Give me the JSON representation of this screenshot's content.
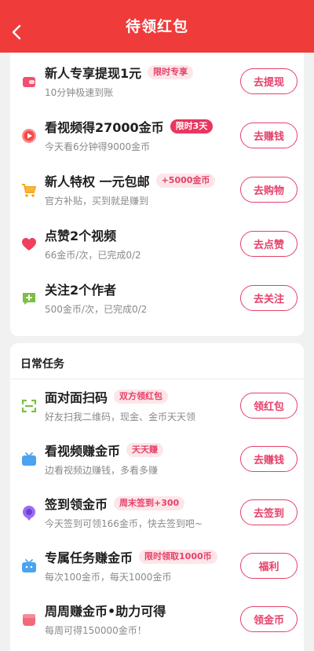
{
  "header": {
    "title": "待领红包",
    "back_icon": "chevron-left-icon"
  },
  "colors": {
    "header_bg": "#f03b3b",
    "accent": "#e5416a",
    "badge_bg": "#fde6e8"
  },
  "new_user_tasks": [
    {
      "title": "新人专享提现1元",
      "badge": "限时专享",
      "sub": "10分钟极速到账",
      "button": "去提现",
      "icon": "wallet-icon"
    },
    {
      "title": "看视频得27000金币",
      "badge": "限时3天",
      "sub": "今天看6分钟得9000金币",
      "button": "去赚钱",
      "icon": "play-icon"
    },
    {
      "title": "新人特权 一元包邮",
      "badge": "+5000金币",
      "sub": "官方补贴，买到就是赚到",
      "button": "去购物",
      "icon": "cart-icon"
    },
    {
      "title": "点赞2个视频",
      "badge": "",
      "sub": "66金币/次，已完成0/2",
      "button": "去点赞",
      "icon": "heart-icon"
    },
    {
      "title": "关注2个作者",
      "badge": "",
      "sub": "500金币/次，已完成0/2",
      "button": "去关注",
      "icon": "add-user-icon"
    }
  ],
  "daily": {
    "section_title": "日常任务",
    "tasks": [
      {
        "title": "面对面扫码",
        "badge": "双方领红包",
        "sub": "好友扫我二维码，现金、金币天天领",
        "button": "领红包",
        "icon": "scan-icon"
      },
      {
        "title": "看视频赚金币",
        "badge": "天天赚",
        "sub": "边看视频边赚钱，多看多赚",
        "button": "去赚钱",
        "icon": "tv-icon"
      },
      {
        "title": "签到领金币",
        "badge": "周末签到+300",
        "sub": "今天签到可领166金币，快去签到吧~",
        "button": "去签到",
        "icon": "location-pin-icon"
      },
      {
        "title": "专属任务赚金币",
        "badge": "限时领取1000币",
        "sub": "每次100金币，每天1000金币",
        "button": "福利",
        "icon": "gift-tv-icon"
      },
      {
        "title": "周周赚金币•助力可得",
        "badge": "",
        "sub": "每周可得150000金币！",
        "button": "领金币",
        "icon": "cup-icon"
      }
    ]
  }
}
